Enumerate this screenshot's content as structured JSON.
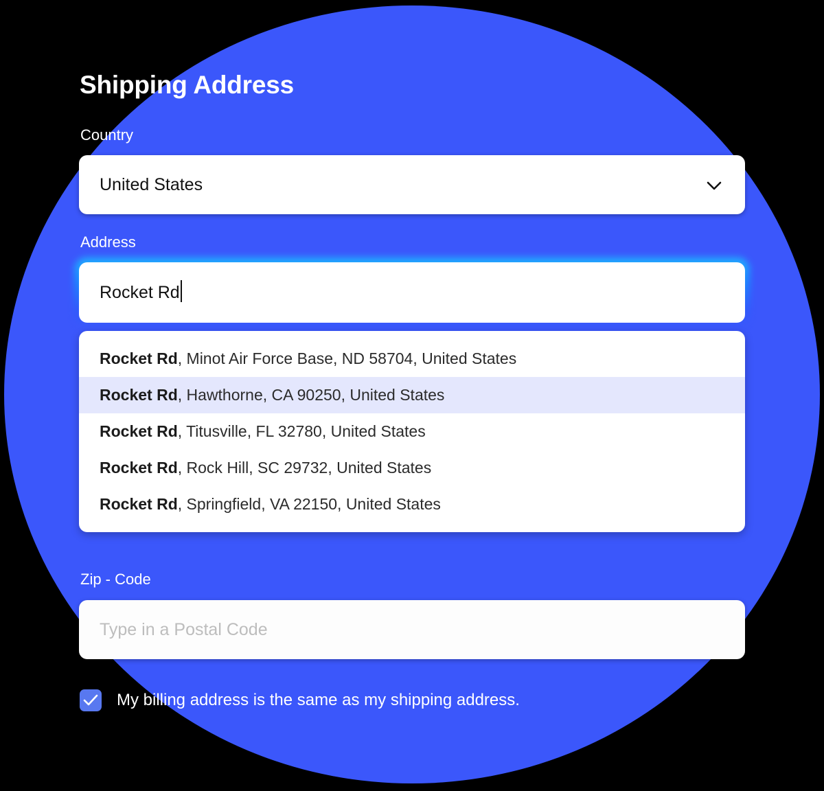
{
  "theme": {
    "circle_color": "#3b57fb",
    "background_color": "#000000",
    "accent_color": "#5878f0",
    "highlight_row_color": "#e4e7fd",
    "focus_glow_color": "#1fb6ff"
  },
  "header": {
    "title": "Shipping Address"
  },
  "country": {
    "label": "Country",
    "value": "United States",
    "icon": "chevron-down-icon"
  },
  "address": {
    "label": "Address",
    "value": "Rocket Rd",
    "focused": true,
    "suggestions": [
      {
        "street": "Rocket Rd",
        "rest": ", Minot Air Force Base, ND 58704, United States",
        "active": false
      },
      {
        "street": "Rocket Rd",
        "rest": ", Hawthorne, CA 90250, United States",
        "active": true
      },
      {
        "street": "Rocket Rd",
        "rest": ", Titusville, FL 32780, United States",
        "active": false
      },
      {
        "street": "Rocket Rd",
        "rest": ", Rock Hill, SC 29732, United States",
        "active": false
      },
      {
        "street": "Rocket Rd",
        "rest": ", Springfield, VA 22150, United States",
        "active": false
      }
    ]
  },
  "zip": {
    "label": "Zip - Code",
    "value": "",
    "placeholder": "Type in a Postal Code"
  },
  "billing": {
    "label": "My billing address is the same as my shipping address.",
    "checked": true
  }
}
